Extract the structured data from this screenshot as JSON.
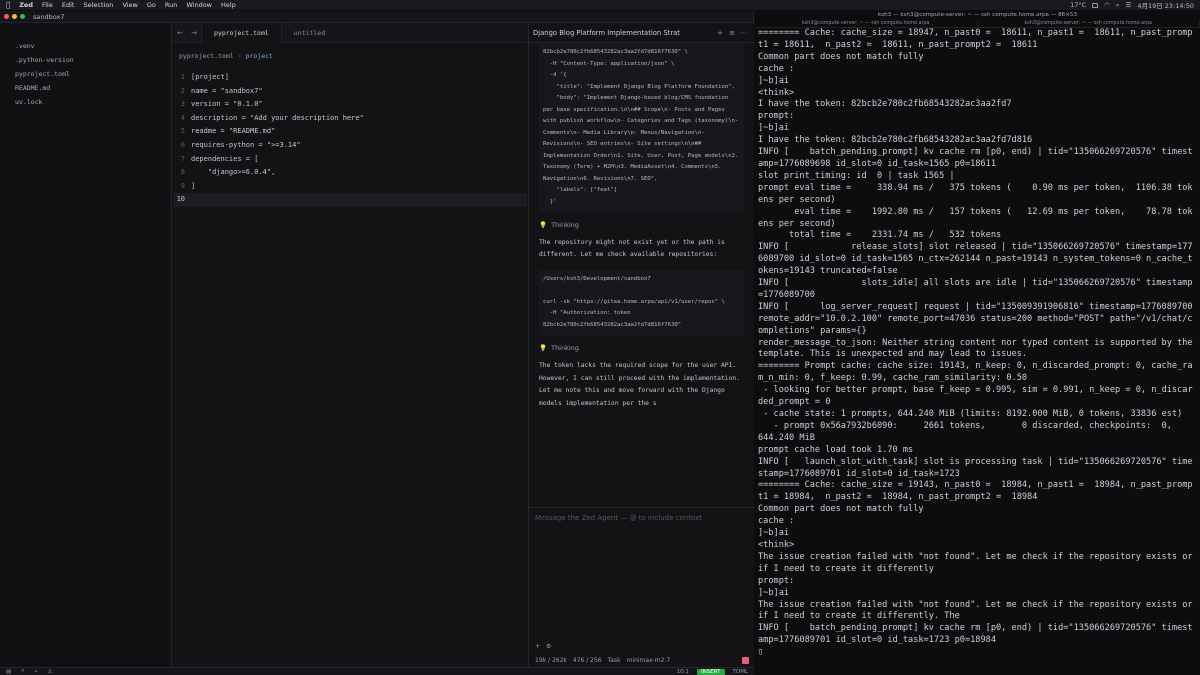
{
  "menubar": {
    "app": "Zed",
    "items": [
      "File",
      "Edit",
      "Selection",
      "View",
      "Go",
      "Run",
      "Window",
      "Help"
    ],
    "datetime": "4月19日 23:14:50",
    "temperature": "17°C"
  },
  "zed": {
    "project_title": "sandbox7",
    "tree": [
      ".venv",
      ".python-version",
      "pyproject.toml",
      "README.md",
      "uv.lock"
    ],
    "tabs": [
      "pyproject.toml",
      "untitled"
    ],
    "breadcrumb": {
      "file": "pyproject.toml",
      "section": "project"
    },
    "code_lines": [
      "[project]",
      "name = \"sandbox7\"",
      "version = \"0.1.0\"",
      "description = \"Add your description here\"",
      "readme = \"README.md\"",
      "requires-python = \">=3.14\"",
      "dependencies = [",
      "    \"django>=6.0.4\",",
      "]",
      ""
    ],
    "line_numbers": [
      "1",
      "2",
      "3",
      "4",
      "5",
      "6",
      "7",
      "8",
      "9",
      "10"
    ]
  },
  "agent": {
    "title": "Django Blog Platform Implementation Strat",
    "code1": "82bcb2e780c2fb68543282ac3aa2fd7d816f7630\" \\\n  -H \"Content-Type: application/json\" \\\n  -d '{\n    \"title\": \"Implement Django Blog Platform Foundation\",\n    \"body\": \"Implement Django-based blog/CMS foundation per base specification.\\n\\n## Scope\\n- Posts and Pages with publish workflow\\n- Categories and Tags (taxonomy)\\n- Comments\\n- Media Library\\n- Menus/Navigation\\n- Revisions\\n- SEO entries\\n- Site settings\\n\\n## Implementation Order\\n1. Site, User, Post, Page models\\n2. Taxonomy (Term) + M2M\\n3. MediaAsset\\n4. Comments\\n5. Navigation\\n6. Revisions\\n7. SEO\",\n    \"labels\": [\"feat\"]\n  }'",
    "thinking1": "Thinking",
    "para1": "The repository might not exist yet or the path is different. Let me check available repositories:",
    "code2": "/Users/ksh3/Development/sandbox7\n\ncurl -sk \"https://gitea.home.arpa/api/v1/user/repos\" \\\n  -H \"Authorization: token 82bcb2e780c2fb68543282ac3aa2fd7d816f7630\"",
    "thinking2": "Thinking",
    "para2": "The token lacks the required scope for the user API. However, I can still proceed with the implementation. Let me note this and move forward with the Django models implementation per the s",
    "input_placeholder": "Message the Zed Agent — @ to include context",
    "tokens": "19k / 262k",
    "edits": "476 / 256",
    "mode": "Task",
    "model": "minimax-m2.7"
  },
  "statusbar": {
    "position": "10:1",
    "mode": "INSERT",
    "lang": "TOML"
  },
  "terminal": {
    "title": "ksh3 — ksh3@compute-server: ~ — ssh compute.home.arpa — 86×53",
    "tabs": [
      "ksh3@compute-server: ~ — ssh compute.home.arpa",
      "ksh3@compute-server: ~ — ssh compute.home.arpa"
    ],
    "text": "======== Cache: cache_size = 18947, n_past0 =  18611, n_past1 =  18611, n_past_prompt1 = 18611,  n_past2 =  18611, n_past_prompt2 =  18611\nCommon part does not match fully\ncache :\n]~b]ai\n<think>\nI have the token: 82bcb2e780c2fb68543282ac3aa2fd7\nprompt:\n]~b]ai\nI have the token: 82bcb2e780c2fb68543282ac3aa2fd7d816\nINFO [    batch_pending_prompt] kv cache rm [p0, end) | tid=\"135066269720576\" timestamp=1776089698 id_slot=0 id_task=1565 p0=18611\nslot print_timing: id  0 | task 1565 |\nprompt eval time =     338.94 ms /   375 tokens (    0.90 ms per token,  1106.38 tokens per second)\n       eval time =    1992.80 ms /   157 tokens (   12.69 ms per token,    78.78 tokens per second)\n      total time =    2331.74 ms /   532 tokens\nINFO [            release_slots] slot released | tid=\"135066269720576\" timestamp=1776089700 id_slot=0 id_task=1565 n_ctx=262144 n_past=19143 n_system_tokens=0 n_cache_tokens=19143 truncated=false\nINFO [              slots_idle] all slots are idle | tid=\"135066269720576\" timestamp=1776089700\nINFO [      log_server_request] request | tid=\"135009391906816\" timestamp=1776089700 remote_addr=\"10.0.2.100\" remote_port=47036 status=200 method=\"POST\" path=\"/v1/chat/completions\" params={}\nrender_message_to_json: Neither string content nor typed content is supported by the template. This is unexpected and may lead to issues.\n======== Prompt cache: cache size: 19143, n_keep: 0, n_discarded_prompt: 0, cache_ram_n_min: 0, f_keep: 0.99, cache_ram_similarity: 0.50\n - looking for better prompt, base f_keep = 0.995, sim = 0.991, n_keep = 0, n_discarded_prompt = 0\n - cache state: 1 prompts, 644.240 MiB (limits: 8192.000 MiB, 0 tokens, 33836 est)\n   - prompt 0x56a7932b6090:     2661 tokens,       0 discarded, checkpoints:  0,    644.240 MiB\nprompt cache load took 1.70 ms\nINFO [   launch_slot_with_task] slot is processing task | tid=\"135066269720576\" timestamp=1776089701 id_slot=0 id_task=1723\n======== Cache: cache_size = 19143, n_past0 =  18984, n_past1 =  18984, n_past_prompt1 = 18984,  n_past2 =  18984, n_past_prompt2 =  18984\nCommon part does not match fully\ncache :\n]~b]ai\n<think>\nThe issue creation failed with \"not found\". Let me check if the repository exists or if I need to create it differently\nprompt:\n]~b]ai\nThe issue creation failed with \"not found\". Let me check if the repository exists or if I need to create it differently. The\nINFO [    batch_pending_prompt] kv cache rm [p0, end) | tid=\"135066269720576\" timestamp=1776089701 id_slot=0 id_task=1723 p0=18984\n▯"
  }
}
